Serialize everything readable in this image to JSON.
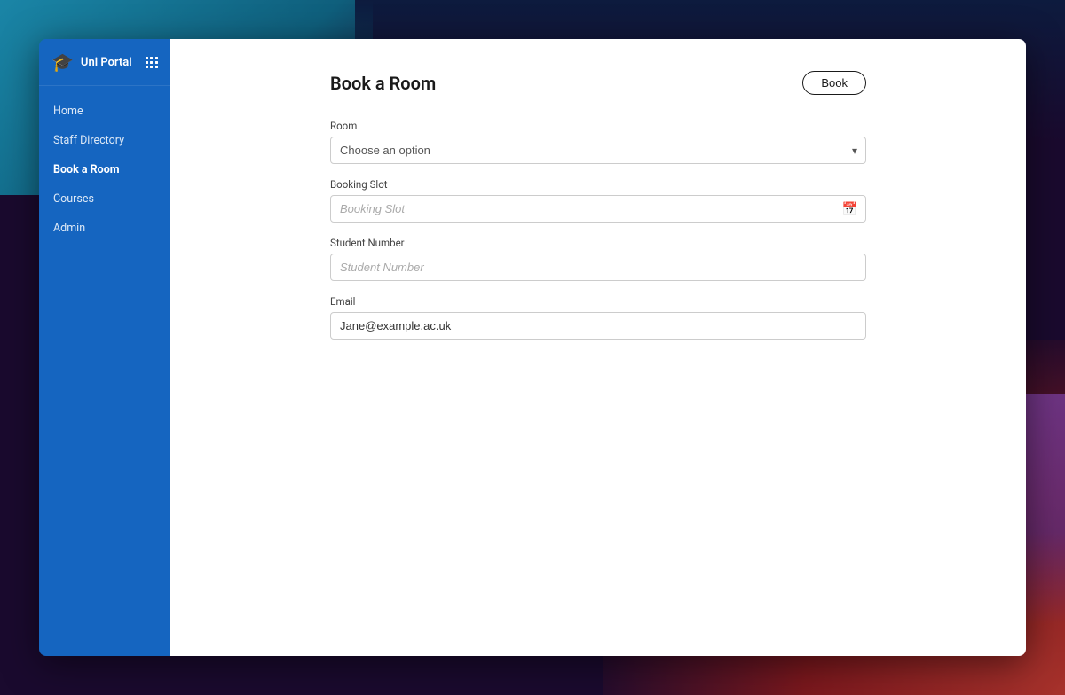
{
  "app": {
    "title": "Uni Portal"
  },
  "sidebar": {
    "nav_items": [
      {
        "id": "home",
        "label": "Home",
        "active": false
      },
      {
        "id": "staff-directory",
        "label": "Staff Directory",
        "active": false
      },
      {
        "id": "book-a-room",
        "label": "Book a Room",
        "active": true
      },
      {
        "id": "courses",
        "label": "Courses",
        "active": false
      },
      {
        "id": "admin",
        "label": "Admin",
        "active": false
      }
    ]
  },
  "page": {
    "title": "Book a Room",
    "book_button_label": "Book"
  },
  "form": {
    "room_label": "Room",
    "room_placeholder": "Choose an option",
    "booking_slot_label": "Booking Slot",
    "booking_slot_placeholder": "Booking Slot",
    "student_number_label": "Student Number",
    "student_number_placeholder": "Student Number",
    "email_label": "Email",
    "email_value": "Jane@example.ac.uk"
  }
}
